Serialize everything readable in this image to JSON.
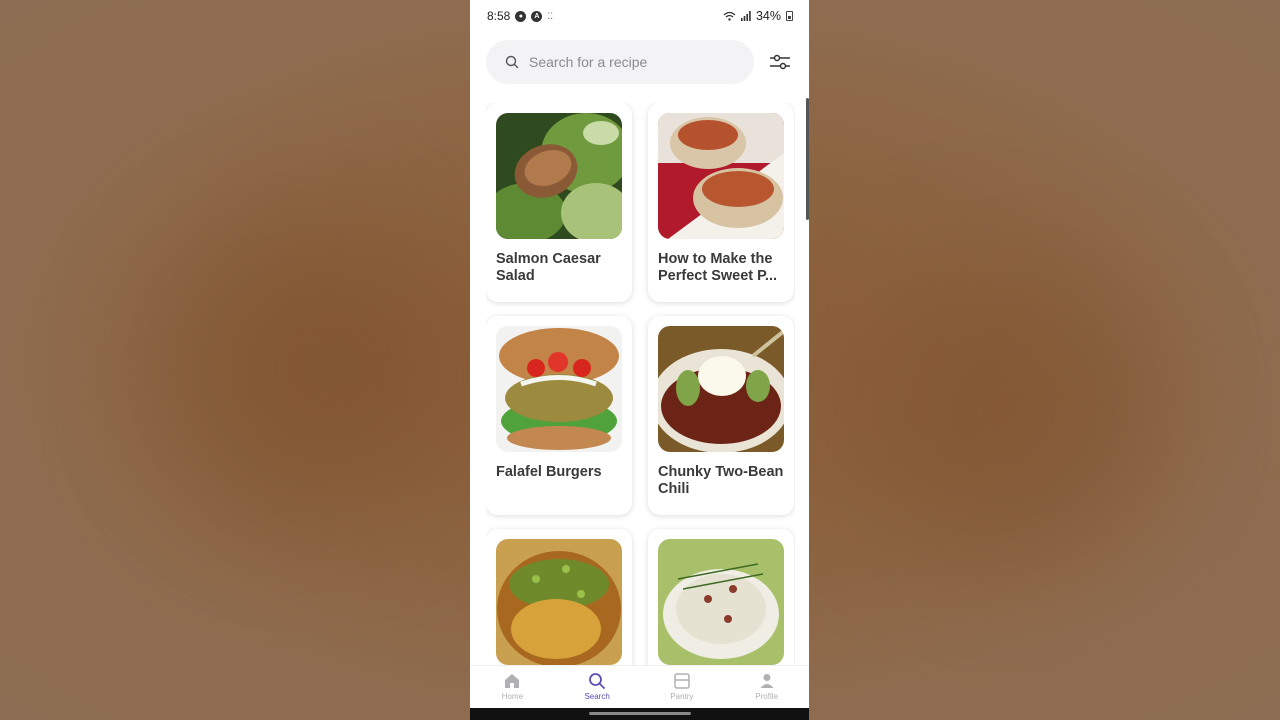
{
  "status": {
    "time": "8:58",
    "battery": "34%"
  },
  "search": {
    "placeholder": "Search for a recipe"
  },
  "recipes": [
    {
      "title": "Salmon Caesar Salad"
    },
    {
      "title": "How to Make the Perfect Sweet P..."
    },
    {
      "title": "Falafel Burgers"
    },
    {
      "title": "Chunky Two-Bean Chili"
    },
    {
      "title": ""
    },
    {
      "title": ""
    }
  ],
  "tabs": [
    {
      "label": "Home",
      "icon": "home-icon"
    },
    {
      "label": "Search",
      "icon": "search-icon",
      "active": true
    },
    {
      "label": "Pantry",
      "icon": "pantry-icon"
    },
    {
      "label": "Profile",
      "icon": "profile-icon"
    }
  ],
  "colors": {
    "accent": "#5b4fb3",
    "search_bg": "#f3f3f5",
    "inactive_tab": "#b0b0b5"
  }
}
